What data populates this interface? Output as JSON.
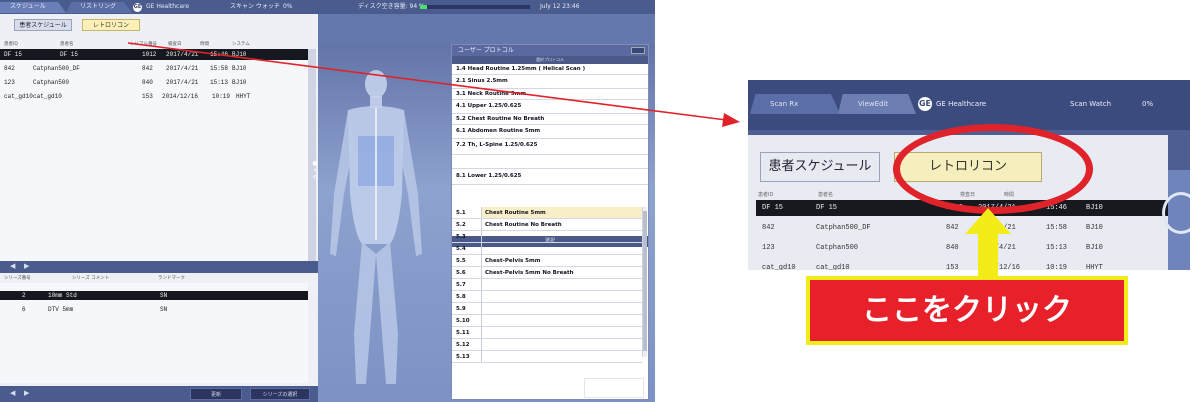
{
  "topbar": {
    "tab1": "スケジュール",
    "tab2": "リストリング",
    "brand": "GE Healthcare",
    "scan_label": "スキャン ウォッチ",
    "scan_pct": "0%",
    "disk_label": "ディスク空き容量: 94 %",
    "disk_fill_pct": 6,
    "datetime": "July 12 23:46"
  },
  "left": {
    "btn_schedule": "患者スケジュール",
    "btn_retro": "レトロリコン",
    "list_headers": [
      "患者ID",
      "患者名",
      "シリアル番号",
      "検査日",
      "時間",
      "システム"
    ],
    "rows": [
      {
        "id": "DF 15",
        "name": "DF 15",
        "exam": "1012",
        "date": "2017/4/21",
        "time": "15:46",
        "sys": "BJ10",
        "selected": true
      },
      {
        "id": "842",
        "name": "Catphan500_DF",
        "exam": "842",
        "date": "2017/4/21",
        "time": "15:58",
        "sys": "BJ10",
        "selected": false
      },
      {
        "id": "123",
        "name": "Catphan500",
        "exam": "840",
        "date": "2017/4/21",
        "time": "15:13",
        "sys": "BJ10",
        "selected": false
      },
      {
        "id": "cat_gd10",
        "name": "cat_gd10",
        "exam": "153",
        "date": "2014/12/16",
        "time": "10:19",
        "sys": "HHYT",
        "selected": false
      }
    ],
    "series_headers": [
      "シリーズ番号",
      "シリーズ コメント",
      "ランドマーク"
    ],
    "series_rows": [
      {
        "num": "2",
        "comment": "10mm Std",
        "land": "SN",
        "selected": true
      },
      {
        "num": "6",
        "comment": "DTV 5mm",
        "land": "SN",
        "selected": false
      }
    ],
    "bottom_btn1": "更新",
    "bottom_btn2": "シリーズの選択"
  },
  "protocol": {
    "title": "ユーザー プロトコル",
    "subtitle": "選択プロトコル",
    "rows": [
      "1.4  Head Routine 1.25mm          ( Helical Scan )",
      "2.1  Sinus 2.5mm",
      "3.1  Neck Routine 5mm",
      "4.1  Upper 1.25/0.625",
      "5.2  Chest Routine No Breath",
      "6.1  Abdomen Routine 5mm",
      "7.2  Th, L-Spine 1.25/0.625",
      "",
      "8.1  Lower 1.25/0.625"
    ],
    "sep": "選択",
    "sub_rows": [
      {
        "num": "5.1",
        "name": "Chest Routine 5mm",
        "hl": true
      },
      {
        "num": "5.2",
        "name": "Chest Routine No Breath",
        "hl": false
      },
      {
        "num": "5.3",
        "name": "",
        "hl": false
      },
      {
        "num": "5.4",
        "name": "",
        "hl": false
      },
      {
        "num": "5.5",
        "name": "Chest-Pelvis 5mm",
        "hl": false
      },
      {
        "num": "5.6",
        "name": "Chest-Pelvis 5mm No Breath",
        "hl": false
      },
      {
        "num": "5.7",
        "name": "",
        "hl": false
      },
      {
        "num": "5.8",
        "name": "",
        "hl": false
      },
      {
        "num": "5.9",
        "name": "",
        "hl": false
      },
      {
        "num": "5.10",
        "name": "",
        "hl": false
      },
      {
        "num": "5.11",
        "name": "",
        "hl": false
      },
      {
        "num": "5.12",
        "name": "",
        "hl": false
      },
      {
        "num": "5.13",
        "name": "",
        "hl": false
      }
    ]
  },
  "zoom": {
    "tab1": "Scan Rx",
    "tab2": "ViewEdit",
    "brand": "GE Healthcare",
    "scan": "Scan Watch",
    "pct": "0%",
    "btn_schedule": "患者スケジュール",
    "btn_retro": "レトロリコン",
    "headers": [
      "患者ID",
      "患者名",
      "検査日",
      "時間"
    ],
    "rows": [
      {
        "id": "DF 15",
        "name": "DF 15",
        "exam": "1012",
        "date": "2017/4/21",
        "time": "15:46",
        "sys": "BJ10"
      },
      {
        "id": "842",
        "name": "Catphan500_DF",
        "exam": "842",
        "date": "2017/4/21",
        "time": "15:58",
        "sys": "BJ10"
      },
      {
        "id": "123",
        "name": "Catphan500",
        "exam": "840",
        "date": "2017/4/21",
        "time": "15:13",
        "sys": "BJ10"
      },
      {
        "id": "cat_gd10",
        "name": "cat_gd10",
        "exam": "153",
        "date": "2014/12/16",
        "time": "10:19",
        "sys": "HHYT"
      }
    ]
  },
  "annotation": {
    "callout_text": "ここをクリック",
    "highlight_color": "#e0222a",
    "arrow_color": "#f2ec18"
  }
}
